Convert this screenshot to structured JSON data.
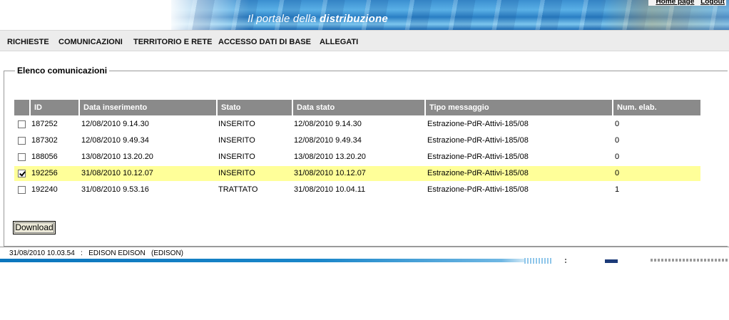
{
  "header": {
    "portal_title_prefix": "Il portale della ",
    "portal_title_emph": "distribuzione",
    "links": [
      "Home page",
      "Logout"
    ]
  },
  "nav": {
    "items": [
      "RICHIESTE",
      "COMUNICAZIONI",
      "TERRITORIO E RETE",
      "ACCESSO DATI DI BASE",
      "ALLEGATI"
    ]
  },
  "panel": {
    "legend": "Elenco comunicazioni"
  },
  "table": {
    "columns": [
      "ID",
      "Data inserimento",
      "Stato",
      "Data stato",
      "Tipo messaggio",
      "Num. elab."
    ],
    "rows": [
      {
        "checked": false,
        "id": "187252",
        "data_inserimento": "12/08/2010 9.14.30",
        "stato": "INSERITO",
        "data_stato": "12/08/2010 9.14.30",
        "tipo": "Estrazione-PdR-Attivi-185/08",
        "num": "0"
      },
      {
        "checked": false,
        "id": "187302",
        "data_inserimento": "12/08/2010 9.49.34",
        "stato": "INSERITO",
        "data_stato": "12/08/2010 9.49.34",
        "tipo": "Estrazione-PdR-Attivi-185/08",
        "num": "0"
      },
      {
        "checked": false,
        "id": "188056",
        "data_inserimento": "13/08/2010 13.20.20",
        "stato": "INSERITO",
        "data_stato": "13/08/2010 13.20.20",
        "tipo": "Estrazione-PdR-Attivi-185/08",
        "num": "0"
      },
      {
        "checked": true,
        "id": "192256",
        "data_inserimento": "31/08/2010 10.12.07",
        "stato": "INSERITO",
        "data_stato": "31/08/2010 10.12.07",
        "tipo": "Estrazione-PdR-Attivi-185/08",
        "num": "0"
      },
      {
        "checked": false,
        "id": "192240",
        "data_inserimento": "31/08/2010 9.53.16",
        "stato": "TRATTATO",
        "data_stato": "31/08/2010 10.04.11",
        "tipo": "Estrazione-PdR-Attivi-185/08",
        "num": "1"
      }
    ]
  },
  "actions": {
    "download_label": "Download"
  },
  "footer": {
    "status_line": "31/08/2010 10.03.54   :   EDISON EDISON   (EDISON)"
  },
  "colors": {
    "header_cell_bg": "#8a8a8a",
    "selected_row_bg": "#ffff99",
    "nav_bg": "#ececec",
    "banner_blue": "#2a7fc4"
  }
}
